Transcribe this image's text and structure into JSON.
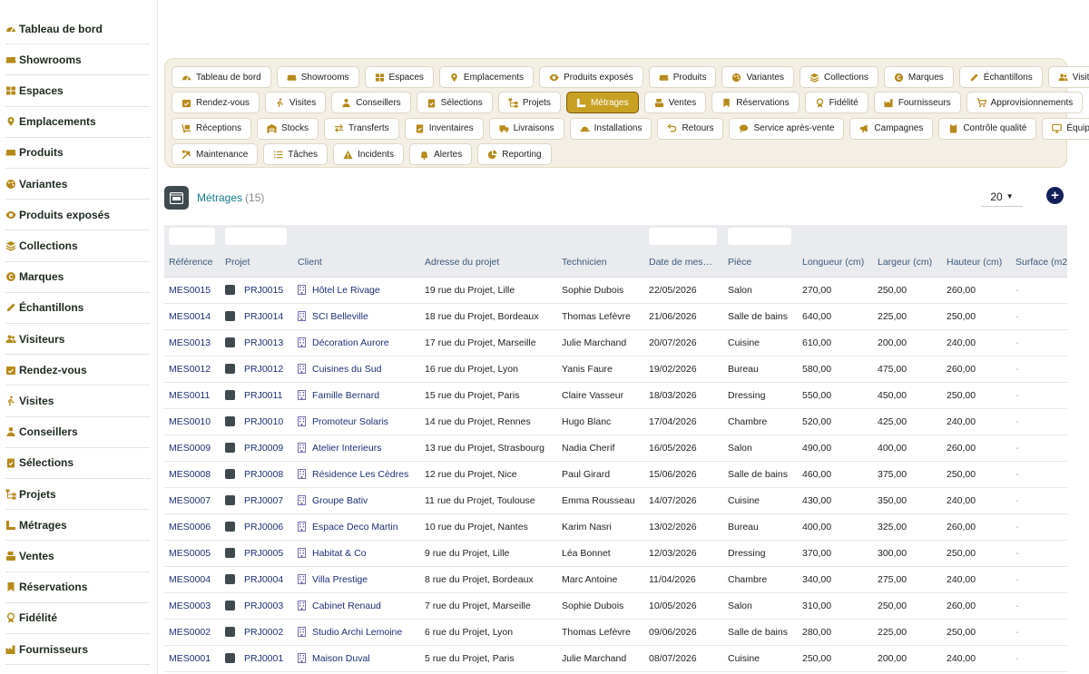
{
  "sidebar": {
    "items": [
      {
        "label": "Tableau de bord",
        "icon": "gauge-icon"
      },
      {
        "label": "Showrooms",
        "icon": "couch-icon"
      },
      {
        "label": "Espaces",
        "icon": "grid-icon"
      },
      {
        "label": "Emplacements",
        "icon": "map-pin-icon"
      },
      {
        "label": "Produits",
        "icon": "couch-icon"
      },
      {
        "label": "Variantes",
        "icon": "palette-icon"
      },
      {
        "label": "Produits exposés",
        "icon": "eye-icon"
      },
      {
        "label": "Collections",
        "icon": "layers-icon"
      },
      {
        "label": "Marques",
        "icon": "copyright-icon"
      },
      {
        "label": "Échantillons",
        "icon": "pen-icon"
      },
      {
        "label": "Visiteurs",
        "icon": "users-icon"
      },
      {
        "label": "Rendez-vous",
        "icon": "calendar-check-icon"
      },
      {
        "label": "Visites",
        "icon": "walking-icon"
      },
      {
        "label": "Conseillers",
        "icon": "user-tie-icon"
      },
      {
        "label": "Sélections",
        "icon": "clipboard-check-icon"
      },
      {
        "label": "Projets",
        "icon": "sitemap-icon"
      },
      {
        "label": "Métrages",
        "icon": "ruler-icon"
      },
      {
        "label": "Ventes",
        "icon": "cash-register-icon"
      },
      {
        "label": "Réservations",
        "icon": "bookmark-icon"
      },
      {
        "label": "Fidélité",
        "icon": "award-icon"
      },
      {
        "label": "Fournisseurs",
        "icon": "industry-icon"
      }
    ]
  },
  "tabs": {
    "rows": [
      [
        {
          "label": "Tableau de bord",
          "icon": "gauge-icon"
        },
        {
          "label": "Showrooms",
          "icon": "couch-icon"
        },
        {
          "label": "Espaces",
          "icon": "grid-icon"
        },
        {
          "label": "Emplacements",
          "icon": "map-pin-icon"
        },
        {
          "label": "Produits exposés",
          "icon": "eye-icon"
        },
        {
          "label": "Produits",
          "icon": "couch-icon"
        },
        {
          "label": "Variantes",
          "icon": "palette-icon"
        },
        {
          "label": "Collections",
          "icon": "layers-icon"
        },
        {
          "label": "Marques",
          "icon": "copyright-icon"
        },
        {
          "label": "Échantillons",
          "icon": "pen-icon"
        },
        {
          "label": "Visiteurs",
          "icon": "users-icon"
        }
      ],
      [
        {
          "label": "Rendez-vous",
          "icon": "calendar-check-icon"
        },
        {
          "label": "Visites",
          "icon": "walking-icon"
        },
        {
          "label": "Conseillers",
          "icon": "user-tie-icon"
        },
        {
          "label": "Sélections",
          "icon": "clipboard-check-icon"
        },
        {
          "label": "Projets",
          "icon": "sitemap-icon"
        },
        {
          "label": "Métrages",
          "icon": "ruler-icon",
          "active": true
        },
        {
          "label": "Ventes",
          "icon": "cash-register-icon"
        },
        {
          "label": "Réservations",
          "icon": "bookmark-icon"
        },
        {
          "label": "Fidélité",
          "icon": "award-icon"
        },
        {
          "label": "Fournisseurs",
          "icon": "industry-icon"
        },
        {
          "label": "Approvisionnements",
          "icon": "cart-icon"
        }
      ],
      [
        {
          "label": "Réceptions",
          "icon": "dolly-icon"
        },
        {
          "label": "Stocks",
          "icon": "warehouse-icon"
        },
        {
          "label": "Transferts",
          "icon": "exchange-icon"
        },
        {
          "label": "Inventaires",
          "icon": "clipboard-check-icon"
        },
        {
          "label": "Livraisons",
          "icon": "truck-icon"
        },
        {
          "label": "Installations",
          "icon": "hard-hat-icon"
        },
        {
          "label": "Retours",
          "icon": "undo-icon"
        },
        {
          "label": "Service après-vente",
          "icon": "comment-icon"
        },
        {
          "label": "Campagnes",
          "icon": "bullhorn-icon"
        },
        {
          "label": "Contrôle qualité",
          "icon": "clipboard-icon"
        },
        {
          "label": "Équipements",
          "icon": "monitor-icon"
        }
      ],
      [
        {
          "label": "Maintenance",
          "icon": "tools-icon"
        },
        {
          "label": "Tâches",
          "icon": "list-icon"
        },
        {
          "label": "Incidents",
          "icon": "warning-icon"
        },
        {
          "label": "Alertes",
          "icon": "bell-icon"
        },
        {
          "label": "Reporting",
          "icon": "pie-chart-icon"
        }
      ]
    ]
  },
  "list": {
    "title": "Métrages",
    "count": "(15)",
    "per_page": "20",
    "columns": [
      "Référence",
      "Projet",
      "Client",
      "Adresse du projet",
      "Technicien",
      "Date de mes…",
      "Pièce",
      "Longueur (cm)",
      "Largeur (cm)",
      "Hauteur (cm)",
      "Surface (m2"
    ],
    "rows": [
      [
        "MES0015",
        "PRJ0015",
        "Hôtel Le Rivage",
        "19 rue du Projet, Lille",
        "Sophie Dubois",
        "22/05/2026",
        "Salon",
        "270,00",
        "250,00",
        "260,00",
        "-"
      ],
      [
        "MES0014",
        "PRJ0014",
        "SCI Belleville",
        "18 rue du Projet, Bordeaux",
        "Thomas Lefèvre",
        "21/06/2026",
        "Salle de bains",
        "640,00",
        "225,00",
        "250,00",
        "-"
      ],
      [
        "MES0013",
        "PRJ0013",
        "Décoration Aurore",
        "17 rue du Projet, Marseille",
        "Julie Marchand",
        "20/07/2026",
        "Cuisine",
        "610,00",
        "200,00",
        "240,00",
        "-"
      ],
      [
        "MES0012",
        "PRJ0012",
        "Cuisines du Sud",
        "16 rue du Projet, Lyon",
        "Yanis Faure",
        "19/02/2026",
        "Bureau",
        "580,00",
        "475,00",
        "260,00",
        "-"
      ],
      [
        "MES0011",
        "PRJ0011",
        "Famille Bernard",
        "15 rue du Projet, Paris",
        "Claire Vasseur",
        "18/03/2026",
        "Dressing",
        "550,00",
        "450,00",
        "250,00",
        "-"
      ],
      [
        "MES0010",
        "PRJ0010",
        "Promoteur Solaris",
        "14 rue du Projet, Rennes",
        "Hugo Blanc",
        "17/04/2026",
        "Chambre",
        "520,00",
        "425,00",
        "240,00",
        "-"
      ],
      [
        "MES0009",
        "PRJ0009",
        "Atelier Interieurs",
        "13 rue du Projet, Strasbourg",
        "Nadia Cherif",
        "16/05/2026",
        "Salon",
        "490,00",
        "400,00",
        "260,00",
        "-"
      ],
      [
        "MES0008",
        "PRJ0008",
        "Résidence Les Cèdres",
        "12 rue du Projet, Nice",
        "Paul Girard",
        "15/06/2026",
        "Salle de bains",
        "460,00",
        "375,00",
        "250,00",
        "-"
      ],
      [
        "MES0007",
        "PRJ0007",
        "Groupe Bativ",
        "11 rue du Projet, Toulouse",
        "Emma Rousseau",
        "14/07/2026",
        "Cuisine",
        "430,00",
        "350,00",
        "240,00",
        "-"
      ],
      [
        "MES0006",
        "PRJ0006",
        "Espace Deco Martin",
        "10 rue du Projet, Nantes",
        "Karim Nasri",
        "13/02/2026",
        "Bureau",
        "400,00",
        "325,00",
        "260,00",
        "-"
      ],
      [
        "MES0005",
        "PRJ0005",
        "Habitat & Co",
        "9 rue du Projet, Lille",
        "Léa Bonnet",
        "12/03/2026",
        "Dressing",
        "370,00",
        "300,00",
        "250,00",
        "-"
      ],
      [
        "MES0004",
        "PRJ0004",
        "Villa Prestige",
        "8 rue du Projet, Bordeaux",
        "Marc Antoine",
        "11/04/2026",
        "Chambre",
        "340,00",
        "275,00",
        "240,00",
        "-"
      ],
      [
        "MES0003",
        "PRJ0003",
        "Cabinet Renaud",
        "7 rue du Projet, Marseille",
        "Sophie Dubois",
        "10/05/2026",
        "Salon",
        "310,00",
        "250,00",
        "260,00",
        "-"
      ],
      [
        "MES0002",
        "PRJ0002",
        "Studio Archi Lemoine",
        "6 rue du Projet, Lyon",
        "Thomas Lefèvre",
        "09/06/2026",
        "Salle de bains",
        "280,00",
        "225,00",
        "250,00",
        "-"
      ],
      [
        "MES0001",
        "PRJ0001",
        "Maison Duval",
        "5 rue du Projet, Paris",
        "Julie Marchand",
        "08/07/2026",
        "Cuisine",
        "250,00",
        "200,00",
        "240,00",
        "-"
      ]
    ]
  },
  "colors": {
    "accent": "#c8a123",
    "icon": "#b58a1a",
    "link": "#1d2f76",
    "title": "#147a8a"
  }
}
